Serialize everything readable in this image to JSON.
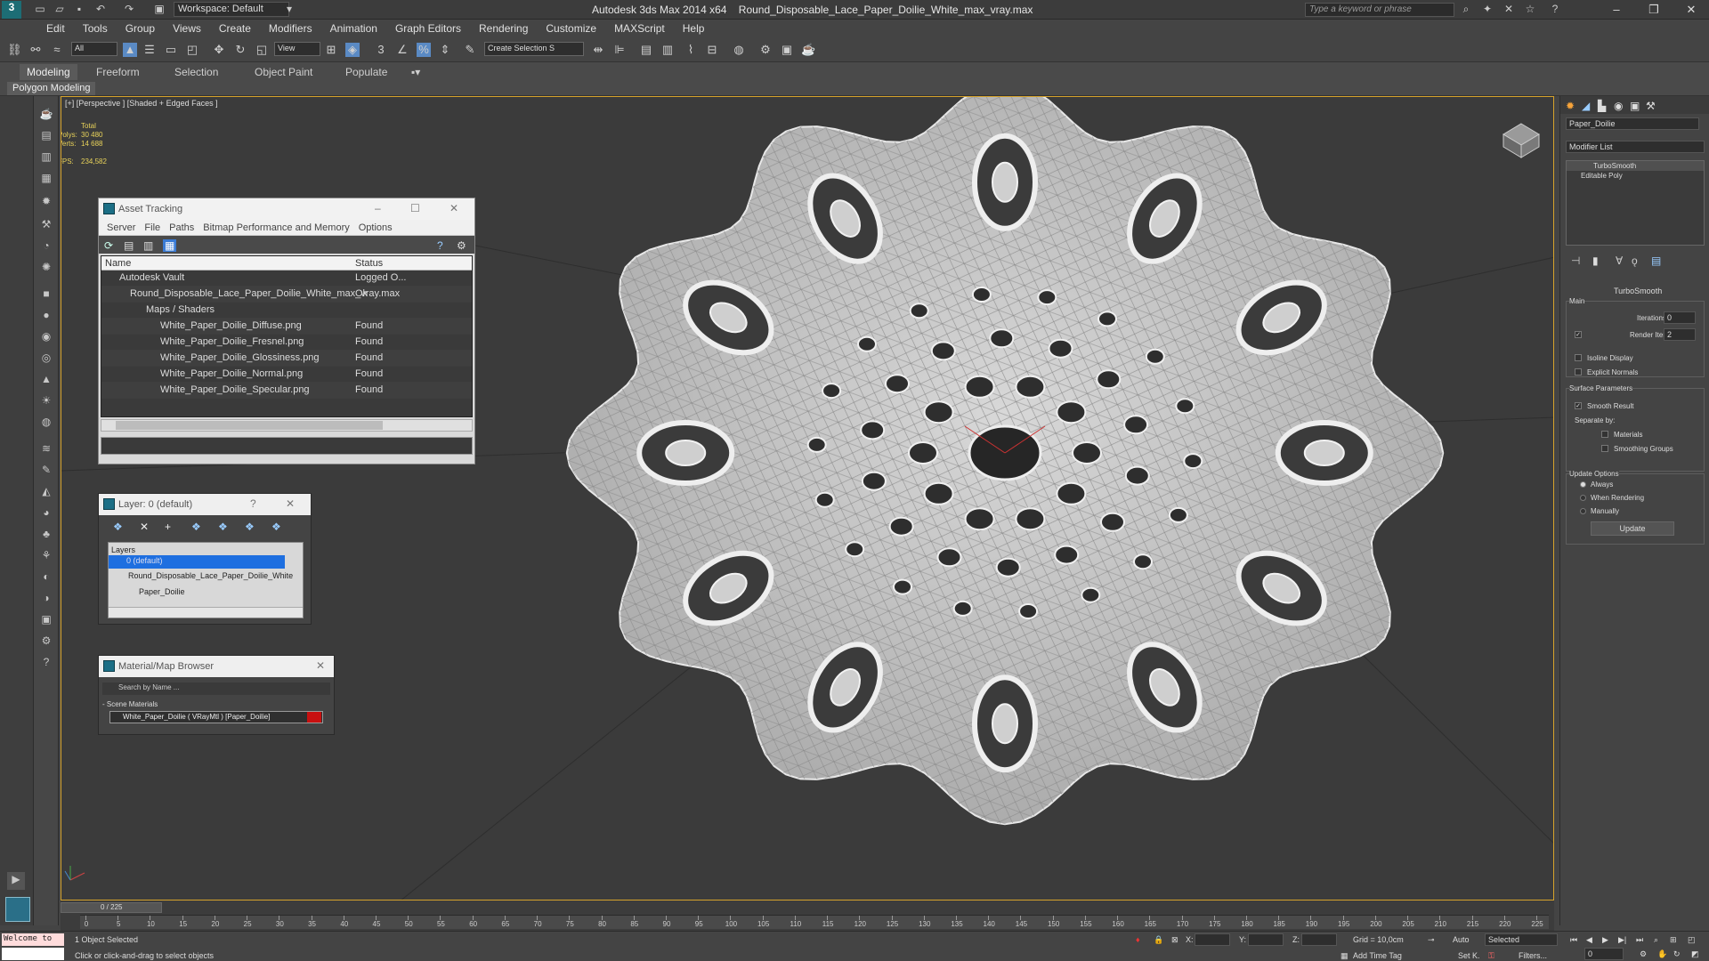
{
  "titlebar": {
    "workspace": "Workspace: Default",
    "app": "Autodesk 3ds Max  2014 x64",
    "file": "Round_Disposable_Lace_Paper_Doilie_White_max_vray.max",
    "search_placeholder": "Type a keyword or phrase"
  },
  "menu": [
    "Edit",
    "Tools",
    "Group",
    "Views",
    "Create",
    "Modifiers",
    "Animation",
    "Graph Editors",
    "Rendering",
    "Customize",
    "MAXScript",
    "Help"
  ],
  "toolbar": {
    "filter": "All",
    "refcoord": "View",
    "selection_set": "Create Selection S"
  },
  "ribbon": {
    "tabs": [
      "Modeling",
      "Freeform",
      "Selection",
      "Object Paint",
      "Populate"
    ],
    "active": "Modeling",
    "sub": "Polygon Modeling"
  },
  "viewport": {
    "label": "[+] [Perspective ] [Shaded + Edged Faces ]",
    "stats_total": "Total",
    "polys_label": "Polys:",
    "polys": "30 480",
    "verts_label": "Verts:",
    "verts": "14 688",
    "fps_label": "FPS:",
    "fps": "234,582"
  },
  "asset_tracking": {
    "title": "Asset Tracking",
    "menu": [
      "Server",
      "File",
      "Paths",
      "Bitmap Performance and Memory",
      "Options"
    ],
    "col_name": "Name",
    "col_status": "Status",
    "rows": [
      {
        "name": "Autodesk Vault",
        "status": "Logged O..."
      },
      {
        "name": "Round_Disposable_Lace_Paper_Doilie_White_max_vray.max",
        "status": "Ok"
      },
      {
        "name": "Maps / Shaders",
        "status": ""
      },
      {
        "name": "White_Paper_Doilie_Diffuse.png",
        "status": "Found"
      },
      {
        "name": "White_Paper_Doilie_Fresnel.png",
        "status": "Found"
      },
      {
        "name": "White_Paper_Doilie_Glossiness.png",
        "status": "Found"
      },
      {
        "name": "White_Paper_Doilie_Normal.png",
        "status": "Found"
      },
      {
        "name": "White_Paper_Doilie_Specular.png",
        "status": "Found"
      }
    ]
  },
  "layer": {
    "title": "Layer: 0 (default)",
    "help": "?",
    "header": "Layers",
    "items": [
      "0 (default)",
      "Round_Disposable_Lace_Paper_Doilie_White",
      "Paper_Doilie"
    ]
  },
  "material_browser": {
    "title": "Material/Map Browser",
    "search_placeholder": "Search by Name ...",
    "section": "- Scene Materials",
    "item": "White_Paper_Doilie  ( VRayMtl ) [Paper_Doilie]"
  },
  "command_panel": {
    "object_name": "Paper_Doilie",
    "modifier_list": "Modifier List",
    "stack": [
      "TurboSmooth",
      "Editable Poly"
    ],
    "rollout": "TurboSmooth",
    "main": "Main",
    "iterations_label": "Iterations:",
    "iterations": "0",
    "render_iters_label": "Render Iters:",
    "render_iters": "2",
    "isoline": "Isoline Display",
    "explicit_normals": "Explicit Normals",
    "surface_params": "Surface Parameters",
    "smooth_result": "Smooth Result",
    "separate_by": "Separate by:",
    "materials": "Materials",
    "smoothing_groups": "Smoothing Groups",
    "update_options": "Update Options",
    "always": "Always",
    "when_rendering": "When Rendering",
    "manually": "Manually",
    "update_btn": "Update"
  },
  "timeline": {
    "frame": "0 / 225",
    "ticks": [
      "0",
      "5",
      "10",
      "15",
      "20",
      "25",
      "30",
      "35",
      "40",
      "45",
      "50",
      "55",
      "60",
      "65",
      "70",
      "75",
      "80",
      "85",
      "90",
      "95",
      "100",
      "105",
      "110",
      "115",
      "120",
      "125",
      "130",
      "135",
      "140",
      "145",
      "150",
      "155",
      "160",
      "165",
      "170",
      "175",
      "180",
      "185",
      "190",
      "195",
      "200",
      "205",
      "210",
      "215",
      "220",
      "225"
    ]
  },
  "status": {
    "maxscript": "Welcome to",
    "selected": "1 Object Selected",
    "prompt": "Click or click-and-drag to select objects",
    "x_label": "X:",
    "y_label": "Y:",
    "z_label": "Z:",
    "grid": "Grid = 10,0cm",
    "add_time_tag": "Add Time Tag",
    "auto": "Auto",
    "set_k": "Set K.",
    "key_mode": "Selected",
    "filters": "Filters...",
    "frame_field": "0"
  }
}
